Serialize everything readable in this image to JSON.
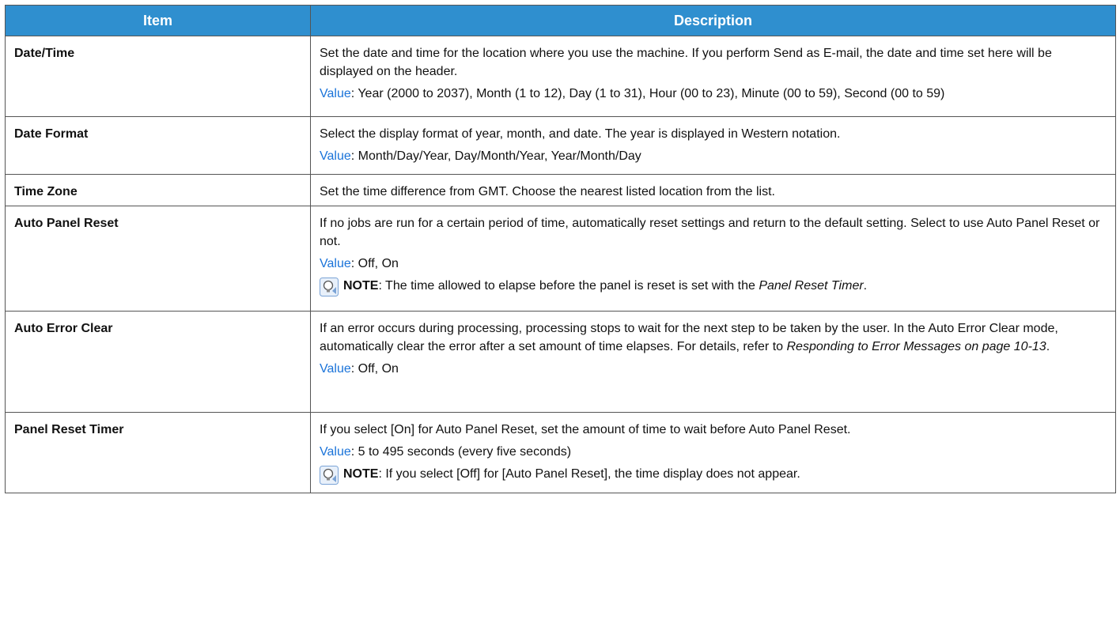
{
  "header": {
    "item": "Item",
    "description": "Description"
  },
  "rows": [
    {
      "item": "Date/Time",
      "desc": "Set the date and time for the location where you use the machine. If you perform Send as E-mail, the date and time set here will be displayed on the header.",
      "value_label": "Value",
      "value": ": Year (2000 to 2037), Month (1 to 12), Day (1 to 31), Hour (00 to 23), Minute (00 to 59), Second (00 to 59)"
    },
    {
      "item": "Date Format",
      "desc": "Select the display format of year, month, and date. The year is displayed in Western notation.",
      "value_label": "Value",
      "value": ": Month/Day/Year, Day/Month/Year, Year/Month/Day"
    },
    {
      "item": "Time Zone",
      "desc": "Set the time difference from GMT. Choose the nearest listed location from the list."
    },
    {
      "item": "Auto Panel Reset",
      "desc": "If no jobs are run for a certain period of time, automatically reset settings and return to the default setting. Select to use Auto Panel Reset or not.",
      "value_label": "Value",
      "value": ": Off, On",
      "note_label": "NOTE",
      "note_text": ": The time allowed to elapse before the panel is reset is set with the ",
      "note_ref": "Panel Reset Timer",
      "note_end": "."
    },
    {
      "item": "Auto Error Clear",
      "desc": "If an error occurs during processing, processing stops to wait for the next step to be taken by the user. In the Auto Error Clear mode, automatically clear the error after a set amount of time elapses. For details, refer to ",
      "desc_ref": "Responding to Error Messages on page 10-13",
      "desc_end": ".",
      "value_label": "Value",
      "value": ": Off, On"
    },
    {
      "item": "Panel Reset Timer",
      "desc": "If you select [On] for Auto Panel Reset, set the amount of time to wait before Auto Panel Reset.",
      "value_label": "Value",
      "value": ": 5 to 495 seconds (every five seconds)",
      "note_label": "NOTE",
      "note_text": ": If you select [Off] for [Auto Panel Reset], the time display does not appear."
    }
  ],
  "icon": "note-lightbulb-icon",
  "colors": {
    "header_bg": "#2f8fcf",
    "header_text": "#ffffff",
    "value_label": "#1a73d9",
    "border": "#555555"
  }
}
